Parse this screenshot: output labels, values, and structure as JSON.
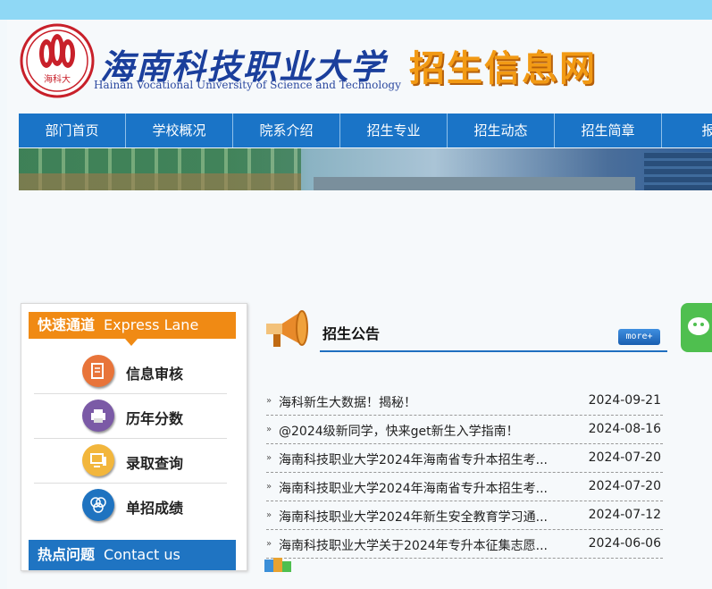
{
  "header": {
    "cn_name": "海南科技职业大学",
    "en_name": "Hainan Vocational University of Science and Technology",
    "site_title": "招生信息网",
    "logo_text": "海科大"
  },
  "nav": {
    "items": [
      "部门首页",
      "学校概况",
      "院系介绍",
      "招生专业",
      "招生动态",
      "招生简章",
      "报考"
    ]
  },
  "sidebar": {
    "express_cn": "快速通道",
    "express_en": "Express Lane",
    "lanes": [
      {
        "label": "信息审核",
        "icon": "document-icon",
        "color": "#e8743a"
      },
      {
        "label": "历年分数",
        "icon": "printer-icon",
        "color": "#7b5aa6"
      },
      {
        "label": "录取查询",
        "icon": "computer-icon",
        "color": "#f2b63c"
      },
      {
        "label": "单招成绩",
        "icon": "rings-icon",
        "color": "#1f73c0"
      }
    ],
    "hot_cn": "热点问题",
    "hot_en": "Contact us"
  },
  "notice": {
    "title": "招生公告",
    "more": "more+",
    "items": [
      {
        "title": "海科新生大数据！揭秘！",
        "date": "2024-09-21"
      },
      {
        "title": "@2024级新同学，快来get新生入学指南！",
        "date": "2024-08-16"
      },
      {
        "title": "海南科技职业大学2024年海南省专升本招生考...",
        "date": "2024-07-20"
      },
      {
        "title": "海南科技职业大学2024年海南省专升本招生考...",
        "date": "2024-07-20"
      },
      {
        "title": "海南科技职业大学2024年新生安全教育学习通...",
        "date": "2024-07-12"
      },
      {
        "title": "海南科技职业大学关于2024年专升本征集志愿...",
        "date": "2024-06-06"
      }
    ]
  },
  "colors": {
    "nav": "#1a74c7",
    "express": "#f08a14",
    "hot": "#1f74c2",
    "title": "#f29a14"
  }
}
